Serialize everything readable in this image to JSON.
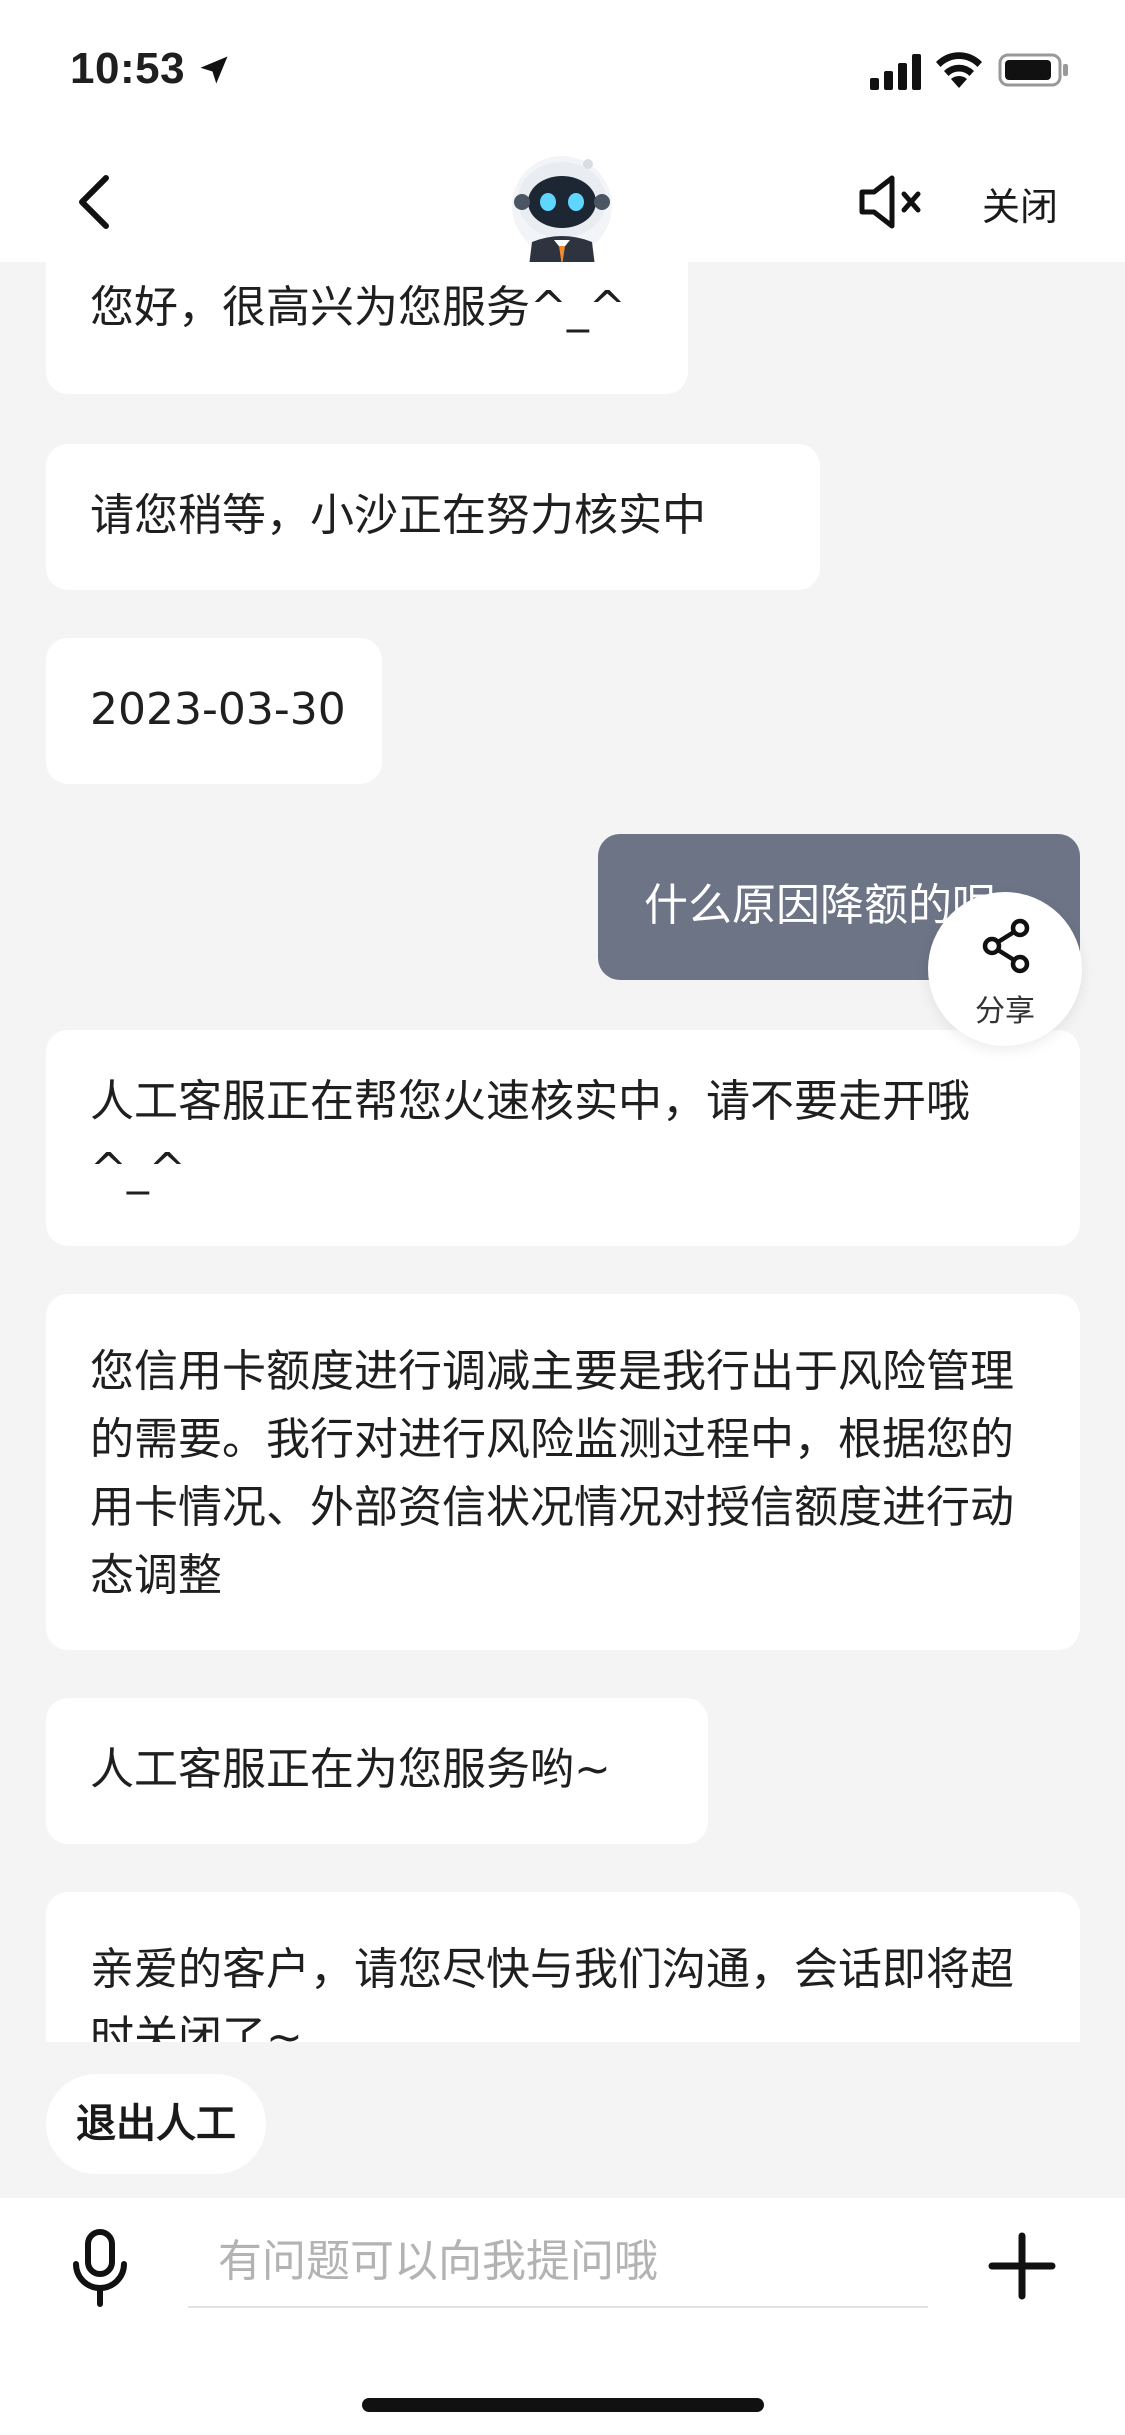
{
  "status_bar": {
    "time": "10:53"
  },
  "nav": {
    "close_label": "关闭"
  },
  "messages": [
    {
      "sender": "agent",
      "text": "您好，很高兴为您服务^_^"
    },
    {
      "sender": "agent",
      "text": "请您稍等，小沙正在努力核实中"
    },
    {
      "sender": "agent",
      "text": "2023-03-30"
    },
    {
      "sender": "user",
      "text": "什么原因降额的呢"
    },
    {
      "sender": "agent",
      "text": "人工客服正在帮您火速核实中，请不要走开哦^_^"
    },
    {
      "sender": "agent",
      "text": "您信用卡额度进行调减主要是我行出于风险管理的需要。我行对进行风险监测过程中，根据您的用卡情况、外部资信状况情况对授信额度进行动态调整"
    },
    {
      "sender": "agent",
      "text": "人工客服正在为您服务哟~"
    },
    {
      "sender": "agent",
      "text": "亲爱的客户，请您尽快与我们沟通，会话即将超时关闭了~"
    }
  ],
  "share": {
    "label": "分享"
  },
  "exit_human_label": "退出人工",
  "input": {
    "placeholder": "有问题可以向我提问哦",
    "value": ""
  },
  "colors": {
    "user_bubble": "#6c7486",
    "agent_bubble": "#ffffff",
    "background": "#f4f4f4"
  },
  "icons": {
    "back": "chevron-left-icon",
    "avatar": "robot-avatar",
    "mute": "speaker-muted-icon",
    "share": "share-icon",
    "mic": "microphone-icon",
    "plus": "plus-icon"
  }
}
